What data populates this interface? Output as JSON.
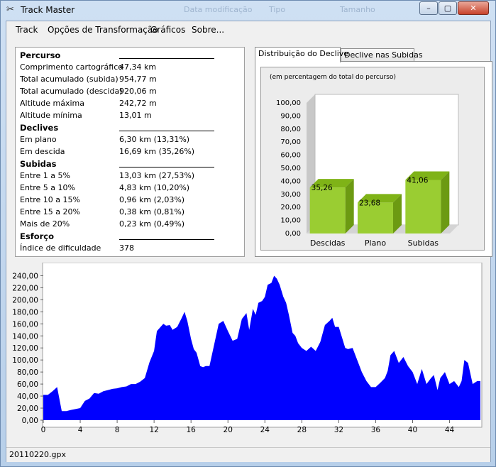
{
  "window": {
    "title": "Track Master",
    "ghost_columns": [
      "Data modificação",
      "Tipo",
      "Tamanho"
    ],
    "controls": [
      "–",
      "▢",
      "✕"
    ]
  },
  "menu": [
    "Track",
    "Opções de Transformação",
    "Gráficos",
    "Sobre..."
  ],
  "stats": {
    "percurso": {
      "title": "Percurso",
      "rows": [
        {
          "label": "Comprimento cartográfico",
          "value": "47,34 km"
        },
        {
          "label": "Total acumulado (subida)",
          "value": "954,77 m"
        },
        {
          "label": "Total acumulado (descida)",
          "value": "920,06 m"
        },
        {
          "label": "Altitude máxima",
          "value": "242,72 m"
        },
        {
          "label": "Altitude mínima",
          "value": "13,01 m"
        }
      ]
    },
    "declives": {
      "title": "Declives",
      "rows": [
        {
          "label": "Em plano",
          "value": "6,30 km (13,31%)"
        },
        {
          "label": "Em descida",
          "value": "16,69 km (35,26%)"
        }
      ]
    },
    "subidas": {
      "title": "Subidas",
      "rows": [
        {
          "label": "Entre 1 a 5%",
          "value": "13,03 km (27,53%)"
        },
        {
          "label": "Entre 5 a 10%",
          "value": "4,83 km (10,20%)"
        },
        {
          "label": "Entre 10 a 15%",
          "value": "0,96 km (2,03%)"
        },
        {
          "label": "Entre 15 a 20%",
          "value": "0,38 km (0,81%)"
        },
        {
          "label": "Mais de 20%",
          "value": "0,23 km (0,49%)"
        }
      ]
    },
    "esforco": {
      "title": "Esforço",
      "rows": [
        {
          "label": "Índice de dificuldade",
          "value": "378"
        }
      ]
    }
  },
  "tabs": [
    "Distribuição do Declive",
    "Declive nas Subidas"
  ],
  "status": "20110220.gpx",
  "chart_data": [
    {
      "type": "bar",
      "subtitle": "(em percentagem do total do percurso)",
      "categories": [
        "Descidas",
        "Plano",
        "Subidas"
      ],
      "values": [
        35.26,
        23.68,
        41.06
      ],
      "value_labels": [
        "35,26",
        "23,68",
        "41,06"
      ],
      "ylim": [
        0,
        100
      ],
      "yticks": [
        "0,00",
        "10,00",
        "20,00",
        "30,00",
        "40,00",
        "50,00",
        "60,00",
        "70,00",
        "80,00",
        "90,00",
        "100,00"
      ],
      "color": "#9acd32",
      "style": "3d"
    },
    {
      "type": "area",
      "xlim": [
        0,
        47.34
      ],
      "ylim": [
        0,
        250
      ],
      "xticks": [
        "0",
        "4",
        "8",
        "12",
        "16",
        "20",
        "24",
        "28",
        "32",
        "36",
        "40",
        "44"
      ],
      "yticks": [
        "0,00",
        "20,00",
        "40,00",
        "60,00",
        "80,00",
        "100,00",
        "120,00",
        "140,00",
        "160,00",
        "180,00",
        "200,00",
        "220,00",
        "240,00"
      ],
      "color": "#0000ff",
      "x": [
        0,
        0.5,
        1,
        1.5,
        2,
        2.5,
        3,
        4,
        4.5,
        5,
        5.5,
        6,
        6.5,
        7,
        7.5,
        8,
        8.5,
        9,
        9.5,
        10,
        10.5,
        11,
        11.5,
        12,
        12.3,
        12.7,
        13,
        13.3,
        13.7,
        14,
        14.5,
        15,
        15.3,
        15.6,
        16,
        16.3,
        16.6,
        17,
        17.3,
        17.6,
        18,
        18.5,
        19,
        19.5,
        20,
        20.5,
        21,
        21.5,
        22,
        22.3,
        22.7,
        23,
        23.3,
        23.7,
        24,
        24.3,
        24.7,
        25,
        25.3,
        25.6,
        26,
        26.3,
        26.6,
        27,
        27.3,
        27.6,
        28,
        28.5,
        29,
        29.5,
        30,
        30.5,
        31,
        31.3,
        31.6,
        32,
        32.3,
        32.7,
        33,
        33.5,
        34,
        34.5,
        35,
        35.5,
        36,
        36.5,
        37,
        37.3,
        37.6,
        38,
        38.5,
        39,
        39.5,
        40,
        40.5,
        41,
        41.5,
        42,
        42.3,
        42.7,
        43,
        43.5,
        44,
        44.5,
        45,
        45.3,
        45.6,
        46,
        46.5,
        47,
        47.34
      ],
      "y": [
        42,
        42,
        48,
        55,
        15,
        15,
        17,
        20,
        32,
        36,
        45,
        44,
        48,
        50,
        52,
        53,
        55,
        56,
        60,
        60,
        64,
        70,
        96,
        115,
        148,
        155,
        160,
        157,
        158,
        150,
        155,
        170,
        180,
        165,
        135,
        118,
        112,
        90,
        88,
        90,
        90,
        125,
        160,
        165,
        148,
        132,
        135,
        168,
        178,
        150,
        185,
        175,
        195,
        198,
        205,
        225,
        228,
        240,
        235,
        225,
        205,
        195,
        175,
        145,
        140,
        128,
        120,
        115,
        122,
        115,
        130,
        158,
        165,
        170,
        155,
        155,
        140,
        120,
        118,
        120,
        100,
        80,
        65,
        55,
        55,
        62,
        70,
        82,
        108,
        115,
        95,
        105,
        90,
        80,
        60,
        85,
        60,
        70,
        75,
        50,
        70,
        80,
        60,
        65,
        55,
        65,
        100,
        95,
        60,
        65,
        65
      ]
    }
  ]
}
